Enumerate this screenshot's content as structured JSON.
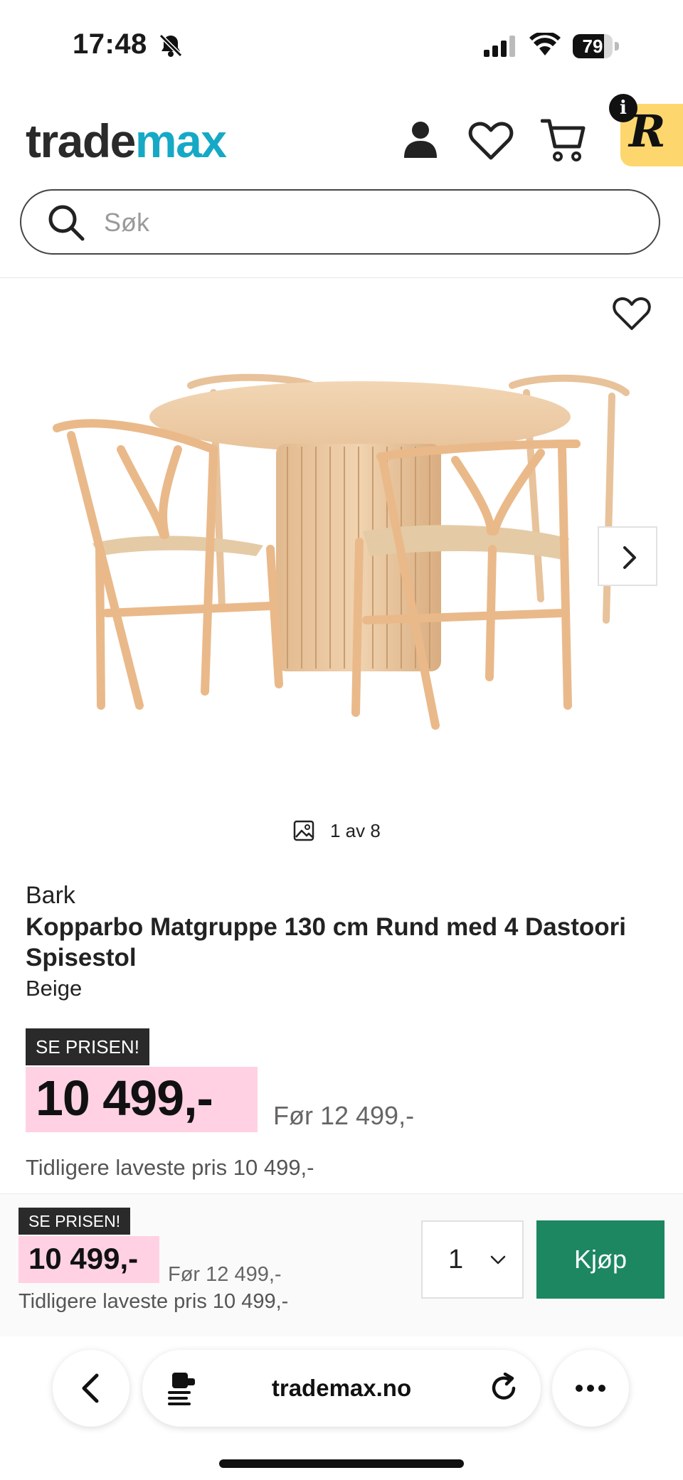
{
  "status_bar": {
    "time": "17:48",
    "battery": "79",
    "battery_level": 0.79
  },
  "header": {
    "logo_part1": "trade",
    "logo_part2": "max",
    "extension_badge": "R",
    "info_badge": "i",
    "colors": {
      "accent": "#16a9c6",
      "badge": "#fdd76e"
    }
  },
  "search": {
    "placeholder": "Søk"
  },
  "gallery": {
    "counter": "1 av 8"
  },
  "product": {
    "brand": "Bark",
    "title": "Kopparbo Matgruppe 130 cm Rund med 4 Dastoori Spisestol",
    "color": "Beige",
    "tag": "SE PRISEN!",
    "price": "10 499,-",
    "before_price": "Før 12 499,-",
    "lowest_price": "Tidligere laveste pris 10 499,-"
  },
  "buy_bar": {
    "tag": "SE PRISEN!",
    "price": "10 499,-",
    "before_price": "Før 12 499,-",
    "lowest_price": "Tidligere laveste pris 10 499,-",
    "quantity": "1",
    "buy_label": "Kjøp",
    "buy_color": "#1d8762"
  },
  "browser": {
    "url": "trademax.no"
  }
}
